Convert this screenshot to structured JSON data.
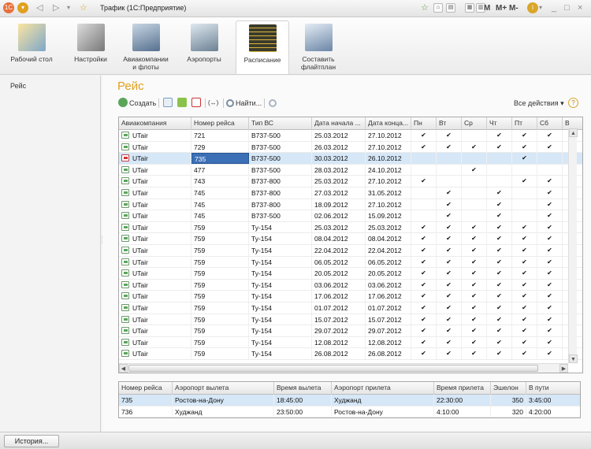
{
  "window": {
    "title": "Трафик  (1С:Предприятие)",
    "m_labels": [
      "M",
      "M+",
      "M-"
    ]
  },
  "sections": [
    {
      "label": "Рабочий стол",
      "icon": "desktop-icon",
      "color": "#7ea7c9"
    },
    {
      "label": "Настройки",
      "icon": "tools-icon",
      "color": "#9a9a9a"
    },
    {
      "label": "Авиакомпании и флоты",
      "icon": "aircraft-icon",
      "color": "#8ba4bd"
    },
    {
      "label": "Аэропорты",
      "icon": "airport-icon",
      "color": "#a3b6c6"
    },
    {
      "label": "Расписание",
      "icon": "timetable-icon",
      "color": "#3b3b2a"
    },
    {
      "label": "Составить флайтплан",
      "icon": "flightplan-icon",
      "color": "#9db2c8"
    }
  ],
  "left_panel": {
    "item": "Рейс"
  },
  "main": {
    "title": "Рейс",
    "toolbar": {
      "create": "Создать",
      "find": "Найти...",
      "all_actions": "Все действия",
      "help": "?"
    }
  },
  "flights_table": {
    "headers": [
      "Авиакомпания",
      "Номер рейса",
      "Тип ВС",
      "Дата начала ...",
      "Дата конца...",
      "Пн",
      "Вт",
      "Ср",
      "Чт",
      "Пт",
      "Сб",
      "В"
    ],
    "rows": [
      {
        "airline": "UTair",
        "number": "721",
        "type": "B737-500",
        "start": "25.03.2012",
        "end": "27.10.2012",
        "days": [
          1,
          1,
          0,
          1,
          1,
          1,
          1
        ]
      },
      {
        "airline": "UTair",
        "number": "729",
        "type": "B737-500",
        "start": "26.03.2012",
        "end": "27.10.2012",
        "days": [
          1,
          1,
          1,
          1,
          1,
          1,
          0
        ]
      },
      {
        "airline": "UTair",
        "number": "735",
        "type": "B737-500",
        "start": "30.03.2012",
        "end": "26.10.2012",
        "days": [
          0,
          0,
          0,
          0,
          1,
          0,
          0
        ]
      },
      {
        "airline": "UTair",
        "number": "477",
        "type": "B737-500",
        "start": "28.03.2012",
        "end": "24.10.2012",
        "days": [
          0,
          0,
          1,
          0,
          0,
          0,
          0
        ]
      },
      {
        "airline": "UTair",
        "number": "743",
        "type": "B737-800",
        "start": "25.03.2012",
        "end": "27.10.2012",
        "days": [
          1,
          0,
          0,
          0,
          1,
          1,
          1
        ]
      },
      {
        "airline": "UTair",
        "number": "745",
        "type": "B737-800",
        "start": "27.03.2012",
        "end": "31.05.2012",
        "days": [
          0,
          1,
          0,
          1,
          0,
          1,
          0
        ]
      },
      {
        "airline": "UTair",
        "number": "745",
        "type": "B737-800",
        "start": "18.09.2012",
        "end": "27.10.2012",
        "days": [
          0,
          1,
          0,
          1,
          0,
          1,
          0
        ]
      },
      {
        "airline": "UTair",
        "number": "745",
        "type": "B737-500",
        "start": "02.06.2012",
        "end": "15.09.2012",
        "days": [
          0,
          1,
          0,
          1,
          0,
          1,
          0
        ]
      },
      {
        "airline": "UTair",
        "number": "759",
        "type": "Ту-154",
        "start": "25.03.2012",
        "end": "25.03.2012",
        "days": [
          1,
          1,
          1,
          1,
          1,
          1,
          1
        ]
      },
      {
        "airline": "UTair",
        "number": "759",
        "type": "Ту-154",
        "start": "08.04.2012",
        "end": "08.04.2012",
        "days": [
          1,
          1,
          1,
          1,
          1,
          1,
          1
        ]
      },
      {
        "airline": "UTair",
        "number": "759",
        "type": "Ту-154",
        "start": "22.04.2012",
        "end": "22.04.2012",
        "days": [
          1,
          1,
          1,
          1,
          1,
          1,
          1
        ]
      },
      {
        "airline": "UTair",
        "number": "759",
        "type": "Ту-154",
        "start": "06.05.2012",
        "end": "06.05.2012",
        "days": [
          1,
          1,
          1,
          1,
          1,
          1,
          1
        ]
      },
      {
        "airline": "UTair",
        "number": "759",
        "type": "Ту-154",
        "start": "20.05.2012",
        "end": "20.05.2012",
        "days": [
          1,
          1,
          1,
          1,
          1,
          1,
          1
        ]
      },
      {
        "airline": "UTair",
        "number": "759",
        "type": "Ту-154",
        "start": "03.06.2012",
        "end": "03.06.2012",
        "days": [
          1,
          1,
          1,
          1,
          1,
          1,
          1
        ]
      },
      {
        "airline": "UTair",
        "number": "759",
        "type": "Ту-154",
        "start": "17.06.2012",
        "end": "17.06.2012",
        "days": [
          1,
          1,
          1,
          1,
          1,
          1,
          1
        ]
      },
      {
        "airline": "UTair",
        "number": "759",
        "type": "Ту-154",
        "start": "01.07.2012",
        "end": "01.07.2012",
        "days": [
          1,
          1,
          1,
          1,
          1,
          1,
          1
        ]
      },
      {
        "airline": "UTair",
        "number": "759",
        "type": "Ту-154",
        "start": "15.07.2012",
        "end": "15.07.2012",
        "days": [
          1,
          1,
          1,
          1,
          1,
          1,
          1
        ]
      },
      {
        "airline": "UTair",
        "number": "759",
        "type": "Ту-154",
        "start": "29.07.2012",
        "end": "29.07.2012",
        "days": [
          1,
          1,
          1,
          1,
          1,
          1,
          1
        ]
      },
      {
        "airline": "UTair",
        "number": "759",
        "type": "Ту-154",
        "start": "12.08.2012",
        "end": "12.08.2012",
        "days": [
          1,
          1,
          1,
          1,
          1,
          1,
          1
        ]
      },
      {
        "airline": "UTair",
        "number": "759",
        "type": "Ту-154",
        "start": "26.08.2012",
        "end": "26.08.2012",
        "days": [
          1,
          1,
          1,
          1,
          1,
          1,
          1
        ]
      }
    ],
    "selected_row": 2
  },
  "route_table": {
    "headers": [
      "Номер рейса",
      "Аэропорт вылета",
      "Время вылета",
      "Аэропорт прилета",
      "Время прилета",
      "Эшелон",
      "В пути"
    ],
    "rows": [
      {
        "number": "735",
        "from": "Ростов-на-Дону",
        "dep": "18:45:00",
        "to": "Худжанд",
        "arr": "22:30:00",
        "level": "350",
        "duration": "3:45:00"
      },
      {
        "number": "736",
        "from": "Худжанд",
        "dep": "23:50:00",
        "to": "Ростов-на-Дону",
        "arr": "4:10:00",
        "level": "320",
        "duration": "4:20:00"
      }
    ]
  },
  "statusbar": {
    "history_button": "История..."
  },
  "colors": {
    "title_accent": "#e0a020",
    "selection": "#d6e7f7",
    "selected_cell": "#3b6fb6"
  }
}
